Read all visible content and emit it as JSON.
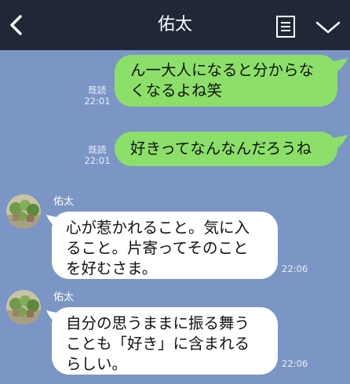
{
  "header": {
    "title": "佑太",
    "back_icon": "chevron-left-icon",
    "menu_icon": "memo-icon",
    "expand_icon": "chevron-down-icon",
    "background": "#202838"
  },
  "chat": {
    "background": "#7b95c5",
    "outgoing_color": "#8ce069",
    "incoming_color": "#ffffff",
    "messages": [
      {
        "direction": "outgoing",
        "lines": [
          "ん一大人になると分からな",
          "くなるよね笑"
        ],
        "read_label": "既読",
        "time": "22:01"
      },
      {
        "direction": "outgoing",
        "lines": [
          "好きってなんなんだろうね"
        ],
        "read_label": "既読",
        "time": "22:01"
      },
      {
        "direction": "incoming",
        "sender": "佑太",
        "lines": [
          "心が惹かれること。気に入",
          "ること。片寄ってそのこと",
          "を好むさま。"
        ],
        "time": "22:06"
      },
      {
        "direction": "incoming",
        "sender": "佑太",
        "lines": [
          "自分の思うままに振る舞う",
          "ことも「好き」に含まれる",
          "らしい。"
        ],
        "time": "22:06"
      }
    ]
  }
}
